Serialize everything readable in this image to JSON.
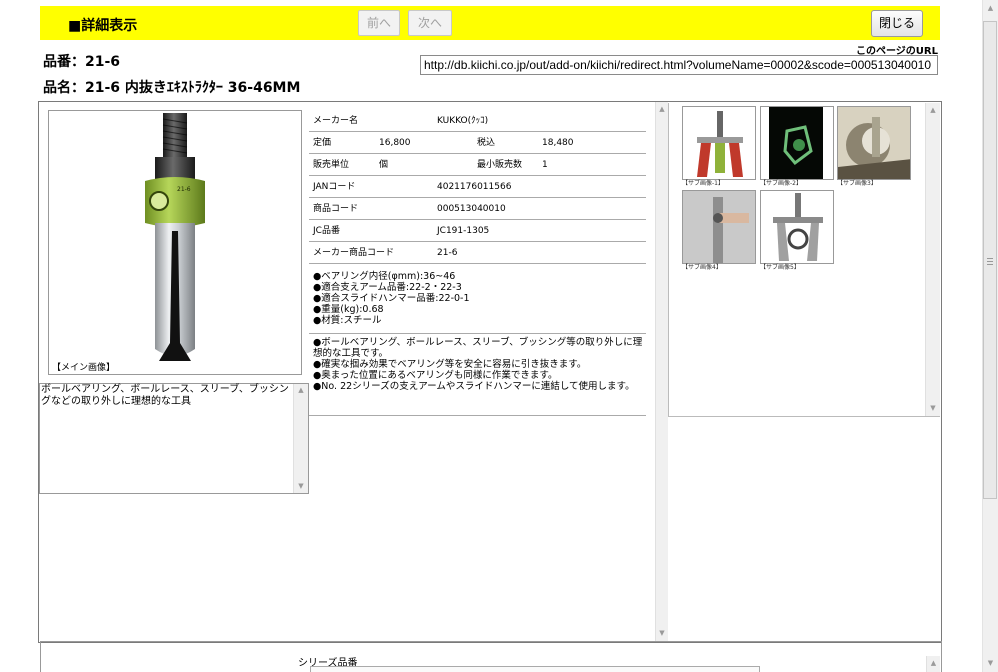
{
  "header": {
    "title": "■詳細表示",
    "prev_label": "前へ",
    "next_label": "次へ",
    "close_label": "閉じる"
  },
  "product": {
    "code_line": "品番：21-6",
    "name_line": "品名：21-6 内抜きｴｷｽﾄﾗｸﾀｰ 36-46MM"
  },
  "page_url": {
    "label": "このページのURL",
    "value": "http://db.kiichi.co.jp/out/add-on/kiichi/redirect.html?volumeName=00002&scode=000513040010"
  },
  "main_image": {
    "caption": "【メイン画像】",
    "label_on_tool": "21-6"
  },
  "description": "ボールベアリング、ボールレース、スリーブ、ブッシングなどの取り外しに理想的な工具",
  "specs": {
    "maker_label": "メーカー名",
    "maker_value": "KUKKO(ｸｯｺ)",
    "price_label": "定価",
    "price_value": "16,800",
    "taxin_label": "税込",
    "taxin_value": "18,480",
    "unit_label": "販売単位",
    "unit_value": "個",
    "minqty_label": "最小販売数",
    "minqty_value": "1",
    "jan_label": "JANコード",
    "jan_value": "4021176011566",
    "code_label": "商品コード",
    "code_value": "000513040010",
    "jc_label": "JC品番",
    "jc_value": "JC191-1305",
    "maker_code_label": "メーカー商品コード",
    "maker_code_value": "21-6"
  },
  "features": [
    "●ベアリング内径(φmm):36~46",
    "●適合支えアーム品番:22-2・22-3",
    "●適合スライドハンマー品番:22-0-1",
    "●重量(kg):0.68",
    "●材質:スチール"
  ],
  "notes": [
    "●ボールベアリング、ボールレース、スリーブ、ブッシング等の取り外しに理想的な工具です。",
    "●確実な掴み効果でベアリング等を安全に容易に引き抜きます。",
    "●奥まった位置にあるベアリングも同様に作業できます。",
    "●No. 22シリーズの支えアームやスライドハンマーに連結して使用します。"
  ],
  "thumbnails": [
    {
      "caption": "【サブ画像-1】"
    },
    {
      "caption": "【サブ画像-2】"
    },
    {
      "caption": "【サブ画像3】"
    },
    {
      "caption": "【サブ画像4】"
    },
    {
      "caption": "【サブ画像5】"
    }
  ],
  "series_label": "シリーズ品番"
}
